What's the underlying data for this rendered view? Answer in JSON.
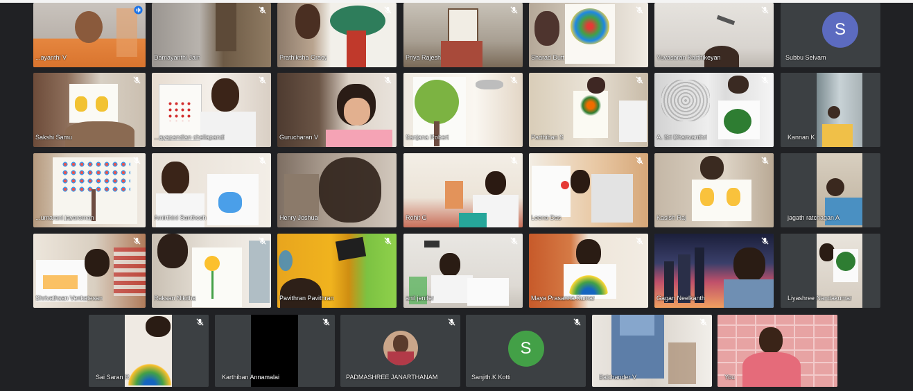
{
  "colors": {
    "background": "#202124",
    "tile": "#3c4043",
    "active_outline": "#8ab4f8"
  },
  "participants": [
    {
      "name": "...ayanthi V",
      "muted": false,
      "active": true,
      "icon": "speaking-indicator-icon"
    },
    {
      "name": "Damayanthi Jain",
      "muted": true
    },
    {
      "name": "Prathiksha Gracy",
      "muted": true
    },
    {
      "name": "Priya Rajesh",
      "muted": true
    },
    {
      "name": "Sharad Dutt",
      "muted": true
    },
    {
      "name": "Yuvasaran Karthikeyan",
      "muted": true
    },
    {
      "name": "Subbu Selvam",
      "muted": false,
      "avatar_letter": "S",
      "avatar_color": "#5c6bc0"
    },
    {
      "name": "Sakshi Samu",
      "muted": true
    },
    {
      "name": "...ayapandian chellapandi",
      "muted": true
    },
    {
      "name": "Gurucharan V",
      "muted": true
    },
    {
      "name": "Sanjana Robert",
      "muted": true
    },
    {
      "name": "Parthiban S",
      "muted": true
    },
    {
      "name": "A. Sri Dhanvanthri",
      "muted": true
    },
    {
      "name": "Kannan K",
      "muted": false
    },
    {
      "name": "...umarani jayaraman",
      "muted": true
    },
    {
      "name": "Amirthini Santhosh",
      "muted": true
    },
    {
      "name": "Henry Joshua",
      "muted": false
    },
    {
      "name": "Rohit G",
      "muted": true
    },
    {
      "name": "Leena Das",
      "muted": true
    },
    {
      "name": "Kasish Raj",
      "muted": true
    },
    {
      "name": "jagath ratchagan A",
      "muted": false
    },
    {
      "name": "Shrivathsan Venkatesan",
      "muted": true
    },
    {
      "name": "Raksan Nikitha",
      "muted": true
    },
    {
      "name": "Pavithran Pavithran",
      "muted": true
    },
    {
      "name": "anil jenifer",
      "muted": true
    },
    {
      "name": "Maya Prasanna Kumar",
      "muted": true
    },
    {
      "name": "Gagan Neelkanth",
      "muted": true
    },
    {
      "name": "Liyashree Nandakumar",
      "muted": false
    },
    {
      "name": "Sai Saran R",
      "muted": true
    },
    {
      "name": "Karthiban Annamalai",
      "muted": true
    },
    {
      "name": "PADMASHREE JANARTHANAM",
      "muted": true
    },
    {
      "name": "Sanjith.K Kotti",
      "muted": true,
      "avatar_letter": "S",
      "avatar_color": "#43a047"
    },
    {
      "name": "Balchander V",
      "muted": true
    },
    {
      "name": "You",
      "muted": false
    }
  ]
}
